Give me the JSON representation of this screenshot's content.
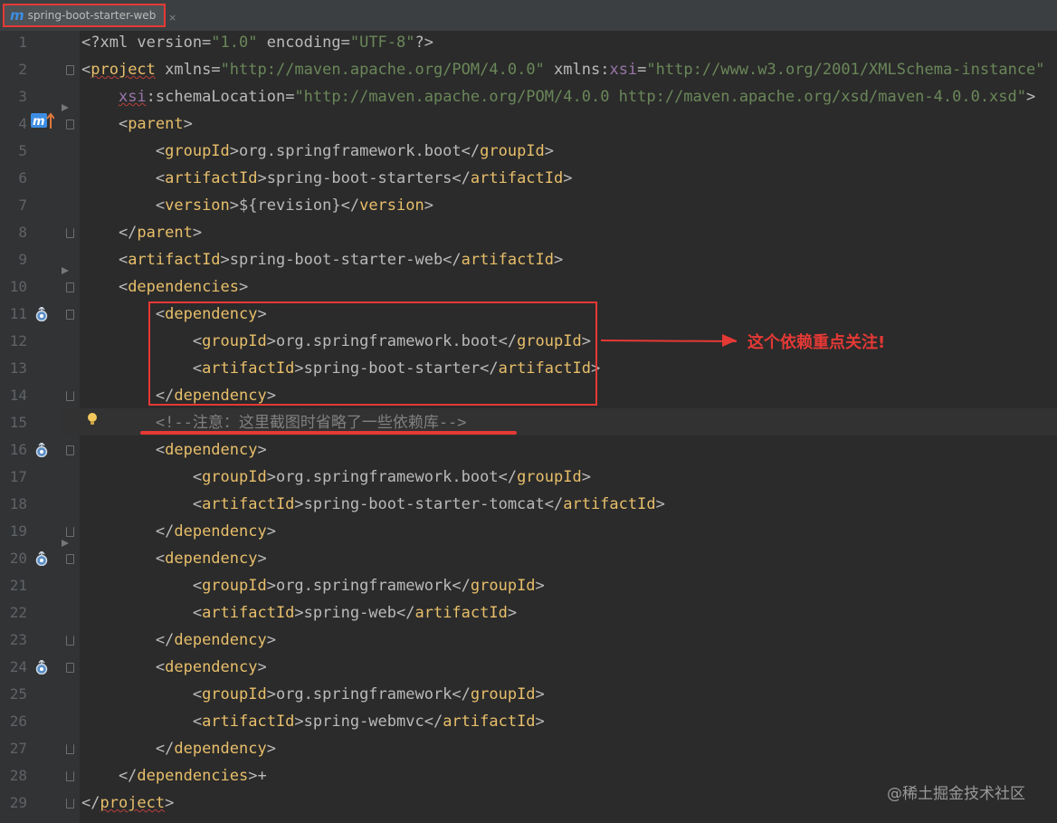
{
  "tab": {
    "logo": "m",
    "title": "spring-boot-starter-web",
    "close": "×"
  },
  "lines": [
    {
      "n": "1",
      "parts": [
        [
          "a",
          "<?xml version="
        ],
        [
          "v",
          "\"1.0\""
        ],
        [
          "a",
          " encoding="
        ],
        [
          "v",
          "\"UTF-8\""
        ],
        [
          "a",
          "?>"
        ]
      ]
    },
    {
      "n": "2",
      "parts": [
        [
          "a",
          "<"
        ],
        [
          "t",
          "project"
        ],
        [
          "a",
          " xmlns="
        ],
        [
          "v",
          "\"http://maven.apache.org/POM/4.0.0\""
        ],
        [
          "a",
          " xmlns:"
        ],
        [
          "ns",
          "xsi"
        ],
        [
          "a",
          "="
        ],
        [
          "v",
          "\"http://www.w3.org/2001/XMLSchema-instance\""
        ]
      ]
    },
    {
      "n": "3",
      "parts": [
        [
          "a",
          "    "
        ],
        [
          "ns",
          "xsi"
        ],
        [
          "a",
          ":schemaLocation="
        ],
        [
          "v",
          "\"http://maven.apache.org/POM/4.0.0 http://maven.apache.org/xsd/maven-4.0.0.xsd\""
        ],
        [
          "a",
          ">"
        ]
      ]
    },
    {
      "n": "4",
      "parts": [
        [
          "a",
          "    <"
        ],
        [
          "t",
          "parent"
        ],
        [
          "a",
          ">"
        ]
      ]
    },
    {
      "n": "5",
      "parts": [
        [
          "a",
          "        <"
        ],
        [
          "t",
          "groupId"
        ],
        [
          "a",
          ">org.springframework.boot</"
        ],
        [
          "t",
          "groupId"
        ],
        [
          "a",
          ">"
        ]
      ]
    },
    {
      "n": "6",
      "parts": [
        [
          "a",
          "        <"
        ],
        [
          "t",
          "artifactId"
        ],
        [
          "a",
          ">spring-boot-starters</"
        ],
        [
          "t",
          "artifactId"
        ],
        [
          "a",
          ">"
        ]
      ]
    },
    {
      "n": "7",
      "parts": [
        [
          "a",
          "        <"
        ],
        [
          "t",
          "version"
        ],
        [
          "a",
          ">${revision}</"
        ],
        [
          "t",
          "version"
        ],
        [
          "a",
          ">"
        ]
      ]
    },
    {
      "n": "8",
      "parts": [
        [
          "a",
          "    </"
        ],
        [
          "t",
          "parent"
        ],
        [
          "a",
          ">"
        ]
      ]
    },
    {
      "n": "9",
      "parts": [
        [
          "a",
          "    <"
        ],
        [
          "t",
          "artifactId"
        ],
        [
          "a",
          ">spring-boot-starter-web</"
        ],
        [
          "t",
          "artifactId"
        ],
        [
          "a",
          ">"
        ]
      ]
    },
    {
      "n": "10",
      "parts": [
        [
          "a",
          "    <"
        ],
        [
          "t",
          "dependencies"
        ],
        [
          "a",
          ">"
        ]
      ]
    },
    {
      "n": "11",
      "parts": [
        [
          "a",
          "        <"
        ],
        [
          "t",
          "dependency"
        ],
        [
          "a",
          ">"
        ]
      ]
    },
    {
      "n": "12",
      "parts": [
        [
          "a",
          "            <"
        ],
        [
          "t",
          "groupId"
        ],
        [
          "a",
          ">org.springframework.boot</"
        ],
        [
          "t",
          "groupId"
        ],
        [
          "a",
          ">"
        ]
      ]
    },
    {
      "n": "13",
      "parts": [
        [
          "a",
          "            <"
        ],
        [
          "t",
          "artifactId"
        ],
        [
          "a",
          ">spring-boot-starter</"
        ],
        [
          "t",
          "artifactId"
        ],
        [
          "a",
          ">"
        ]
      ]
    },
    {
      "n": "14",
      "parts": [
        [
          "a",
          "        </"
        ],
        [
          "t",
          "dependency"
        ],
        [
          "a",
          ">"
        ]
      ]
    },
    {
      "n": "15",
      "parts": [
        [
          "c",
          "        <!--注意：这里截图时省略了一些依赖库-->"
        ]
      ]
    },
    {
      "n": "16",
      "parts": [
        [
          "a",
          "        <"
        ],
        [
          "t",
          "dependency"
        ],
        [
          "a",
          ">"
        ]
      ]
    },
    {
      "n": "17",
      "parts": [
        [
          "a",
          "            <"
        ],
        [
          "t",
          "groupId"
        ],
        [
          "a",
          ">org.springframework.boot</"
        ],
        [
          "t",
          "groupId"
        ],
        [
          "a",
          ">"
        ]
      ]
    },
    {
      "n": "18",
      "parts": [
        [
          "a",
          "            <"
        ],
        [
          "t",
          "artifactId"
        ],
        [
          "a",
          ">spring-boot-starter-tomcat</"
        ],
        [
          "t",
          "artifactId"
        ],
        [
          "a",
          ">"
        ]
      ]
    },
    {
      "n": "19",
      "parts": [
        [
          "a",
          "        </"
        ],
        [
          "t",
          "dependency"
        ],
        [
          "a",
          ">"
        ]
      ]
    },
    {
      "n": "20",
      "parts": [
        [
          "a",
          "        <"
        ],
        [
          "t",
          "dependency"
        ],
        [
          "a",
          ">"
        ]
      ]
    },
    {
      "n": "21",
      "parts": [
        [
          "a",
          "            <"
        ],
        [
          "t",
          "groupId"
        ],
        [
          "a",
          ">org.springframework</"
        ],
        [
          "t",
          "groupId"
        ],
        [
          "a",
          ">"
        ]
      ]
    },
    {
      "n": "22",
      "parts": [
        [
          "a",
          "            <"
        ],
        [
          "t",
          "artifactId"
        ],
        [
          "a",
          ">spring-web</"
        ],
        [
          "t",
          "artifactId"
        ],
        [
          "a",
          ">"
        ]
      ]
    },
    {
      "n": "23",
      "parts": [
        [
          "a",
          "        </"
        ],
        [
          "t",
          "dependency"
        ],
        [
          "a",
          ">"
        ]
      ]
    },
    {
      "n": "24",
      "parts": [
        [
          "a",
          "        <"
        ],
        [
          "t",
          "dependency"
        ],
        [
          "a",
          ">"
        ]
      ]
    },
    {
      "n": "25",
      "parts": [
        [
          "a",
          "            <"
        ],
        [
          "t",
          "groupId"
        ],
        [
          "a",
          ">org.springframework</"
        ],
        [
          "t",
          "groupId"
        ],
        [
          "a",
          ">"
        ]
      ]
    },
    {
      "n": "26",
      "parts": [
        [
          "a",
          "            <"
        ],
        [
          "t",
          "artifactId"
        ],
        [
          "a",
          ">spring-webmvc</"
        ],
        [
          "t",
          "artifactId"
        ],
        [
          "a",
          ">"
        ]
      ]
    },
    {
      "n": "27",
      "parts": [
        [
          "a",
          "        </"
        ],
        [
          "t",
          "dependency"
        ],
        [
          "a",
          ">"
        ]
      ]
    },
    {
      "n": "28",
      "parts": [
        [
          "a",
          "    </"
        ],
        [
          "t",
          "dependencies"
        ],
        [
          "a",
          ">+"
        ]
      ]
    },
    {
      "n": "29",
      "parts": [
        [
          "a",
          "</"
        ],
        [
          "t",
          "project"
        ],
        [
          "a",
          ">"
        ]
      ]
    }
  ],
  "annotation": "这个依赖重点关注!",
  "watermark": "@稀土掘金技术社区",
  "colors": {
    "background": "#2b2b2b",
    "gutter": "#313335",
    "tag": "#e8bf6a",
    "attr_value": "#6a8759",
    "namespace": "#9876aa",
    "comment": "#808080",
    "highlight": "#e53935"
  },
  "icons": {
    "maven_parent": "maven-override-icon",
    "dependency": "dependency-icon",
    "intention": "lightbulb-icon",
    "fold": "fold-marker-icon"
  }
}
